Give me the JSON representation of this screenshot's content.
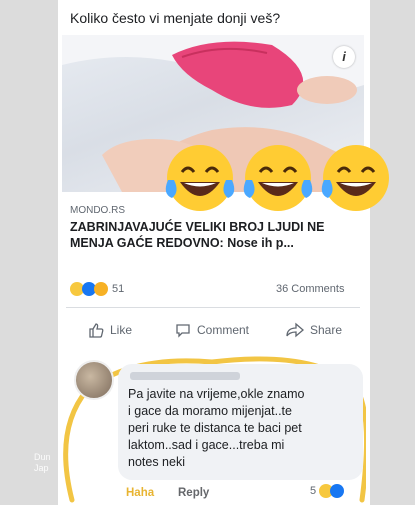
{
  "post": {
    "caption": "Koliko često vi menjate donji veš?",
    "info_label": "i",
    "source": "MONDO.RS",
    "headline": "ZABRINJAVAJUĆE VELIKI BROJ LJUDI NE MENJA GAĆE REDOVNO: Nose ih p...",
    "reaction_count": "51",
    "comments_count": "36 Comments",
    "overlay_emojis": [
      "laughing-emoji",
      "laughing-emoji",
      "laughing-emoji"
    ]
  },
  "actions": {
    "like": "Like",
    "comment": "Comment",
    "share": "Share"
  },
  "comment": {
    "text": "Pa javite na vrijeme,okle znamo\ni gace da moramo mijenjat..te\nperi ruke te distanca te baci pet\nlaktom..sad i gace...treba mi\nnotes neki",
    "haha": "Haha",
    "reply": "Reply",
    "reaction_count": "5"
  },
  "watermark": {
    "line1": "Dun",
    "line2": "Jap"
  },
  "colors": {
    "highlight_ring": "#f2c544",
    "haha": "#e8b431",
    "panties": "#e8457a"
  }
}
